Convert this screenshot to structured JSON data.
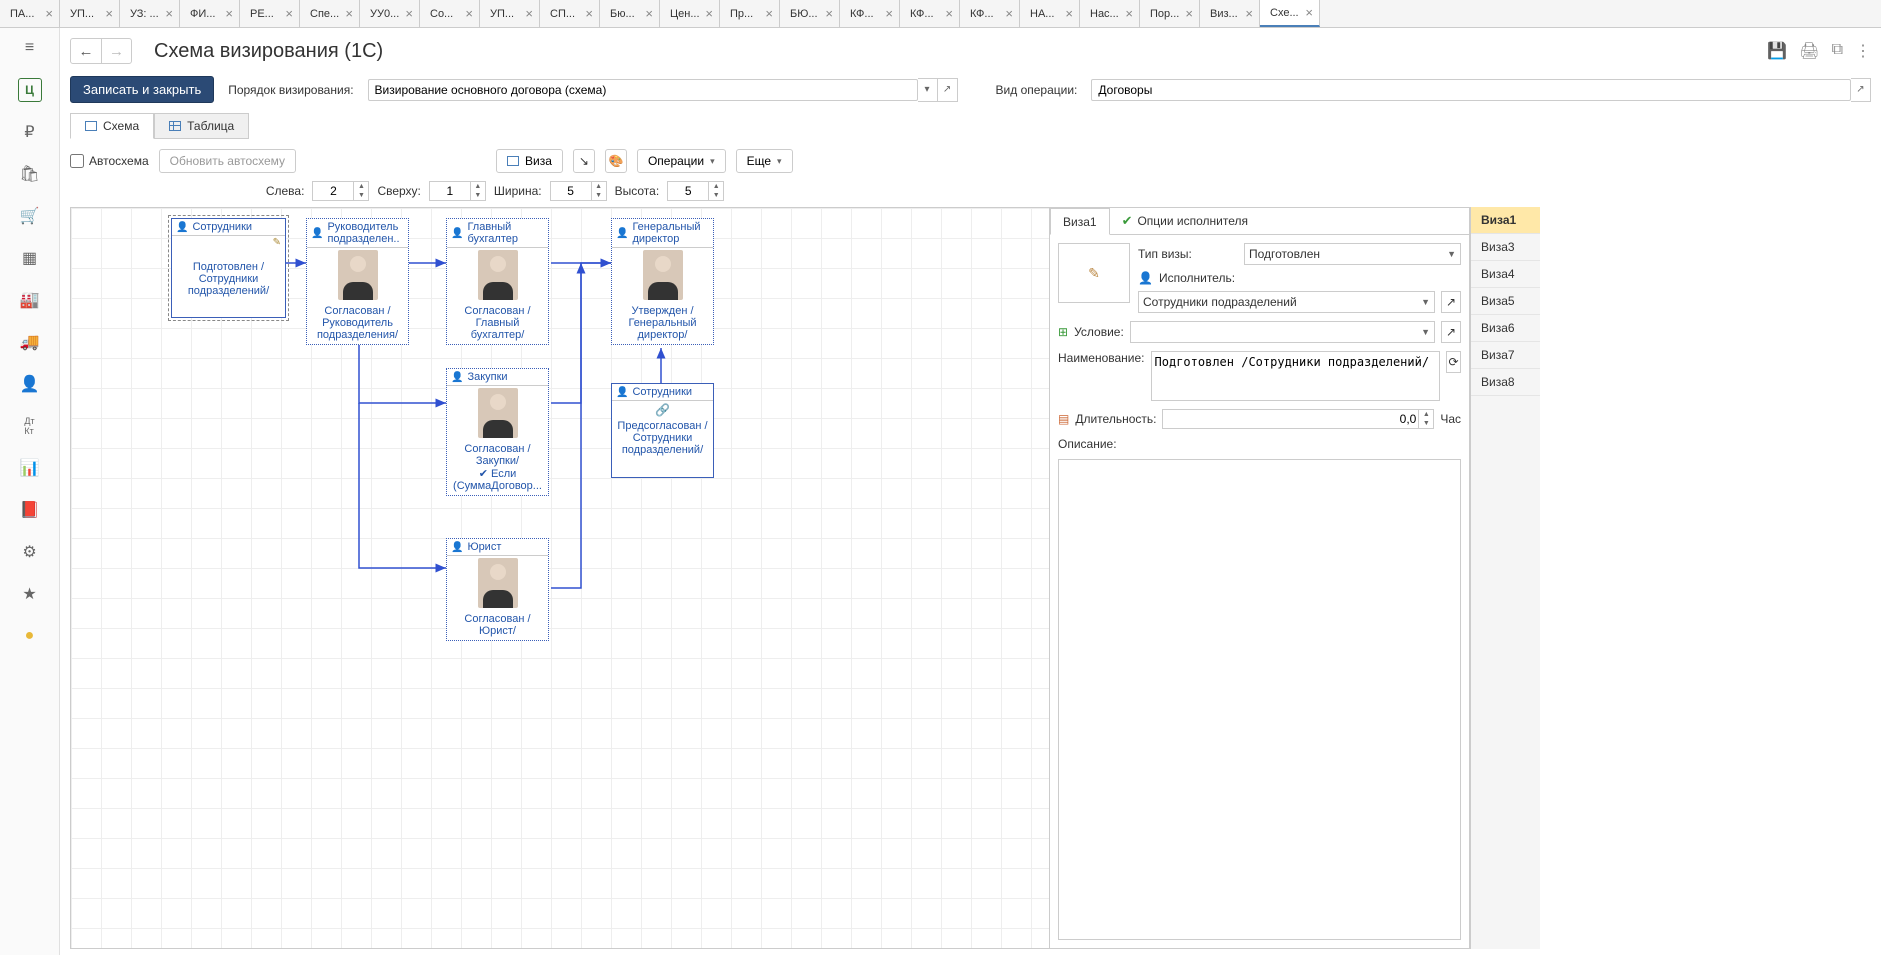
{
  "tabs": [
    {
      "label": "ПА...",
      "close": true
    },
    {
      "label": "УП...",
      "close": true
    },
    {
      "label": "УЗ: ...",
      "close": true
    },
    {
      "label": "ФИ...",
      "close": true
    },
    {
      "label": "РЕ...",
      "close": true
    },
    {
      "label": "Спе...",
      "close": true
    },
    {
      "label": "УУ0...",
      "close": true
    },
    {
      "label": "Со...",
      "close": true
    },
    {
      "label": "УП...",
      "close": true
    },
    {
      "label": "СП...",
      "close": true
    },
    {
      "label": "Бю...",
      "close": true
    },
    {
      "label": "Цен...",
      "close": true
    },
    {
      "label": "Пр...",
      "close": true
    },
    {
      "label": "БЮ...",
      "close": true
    },
    {
      "label": "КФ...",
      "close": true
    },
    {
      "label": "КФ...",
      "close": true
    },
    {
      "label": "КФ...",
      "close": true
    },
    {
      "label": "НА...",
      "close": true
    },
    {
      "label": "Нас...",
      "close": true
    },
    {
      "label": "Пор...",
      "close": true
    },
    {
      "label": "Виз...",
      "close": true
    },
    {
      "label": "Схе...",
      "close": true,
      "active": true
    }
  ],
  "page_title": "Схема визирования (1С)",
  "actions": {
    "save_close": "Записать и закрыть",
    "order_label": "Порядок визирования:",
    "order_value": "Визирование основного договора (схема)",
    "op_label": "Вид операции:",
    "op_value": "Договоры"
  },
  "subtabs": {
    "schema": "Схема",
    "table": "Таблица"
  },
  "toolbar": {
    "autoscheme": "Автосхема",
    "refresh_auto": "Обновить автосхему",
    "visa": "Виза",
    "operations": "Операции",
    "more": "Еще"
  },
  "dims": {
    "left_l": "Слева:",
    "left": "2",
    "top_l": "Сверху:",
    "top": "1",
    "width_l": "Ширина:",
    "width": "5",
    "height_l": "Высота:",
    "height": "5"
  },
  "nodes": {
    "n1": {
      "title": "Сотрудники",
      "status": "Подготовлен /Сотрудники подразделений/"
    },
    "n2": {
      "title": "Руководитель подразделен..",
      "status": "Согласован /Руководитель подразделения/"
    },
    "n3": {
      "title": "Главный бухгалтер",
      "status": "Согласован /Главный бухгалтер/"
    },
    "n4": {
      "title": "Генеральный директор",
      "status": "Утвержден /Генеральный директор/"
    },
    "n5": {
      "title": "Закупки",
      "status": "Согласован /Закупки/",
      "cond": "✔ Если (СуммаДоговор..."
    },
    "n6": {
      "title": "Сотрудники",
      "status": "Предсогласован /Сотрудники подразделений/"
    },
    "n7": {
      "title": "Юрист",
      "status": "Согласован /Юрист/"
    }
  },
  "right": {
    "tab1": "Виза1",
    "tab2": "Опции исполнителя",
    "type_l": "Тип визы:",
    "type_v": "Подготовлен",
    "exec_l": "Исполнитель:",
    "exec_v": "Сотрудники подразделений",
    "cond_l": "Условие:",
    "cond_v": "",
    "name_l": "Наименование:",
    "name_v": "Подготовлен /Сотрудники подразделений/",
    "dur_l": "Длительность:",
    "dur_v": "0,0",
    "dur_unit": "Час",
    "desc_l": "Описание:"
  },
  "visa_list": [
    "Виза1",
    "Виза3",
    "Виза4",
    "Виза5",
    "Виза6",
    "Виза7",
    "Виза8"
  ]
}
